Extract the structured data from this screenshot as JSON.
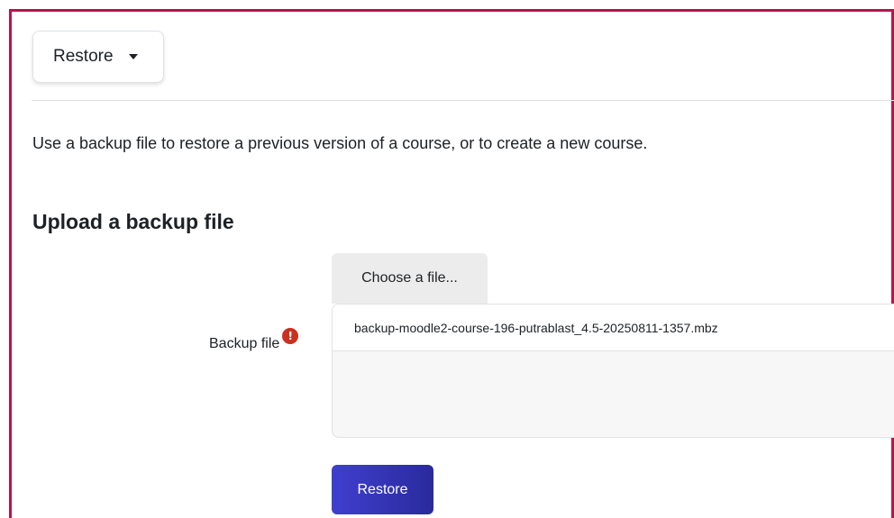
{
  "header": {
    "dropdown_label": "Restore",
    "dropdown_icon": "caret-down-icon"
  },
  "intro_text": "Use a backup file to restore a previous version of a course, or to create a new course.",
  "upload": {
    "heading": "Upload a backup file",
    "field_label": "Backup file",
    "required_icon": "!",
    "choose_file_label": "Choose a file...",
    "file_name": "backup-moodle2-course-196-putrablast_4.5-20250811-1357.mbz",
    "submit_label": "Restore"
  },
  "colors": {
    "frame_border": "#b5154a",
    "primary_button": "#3a3ac4",
    "required": "#ca3120"
  }
}
